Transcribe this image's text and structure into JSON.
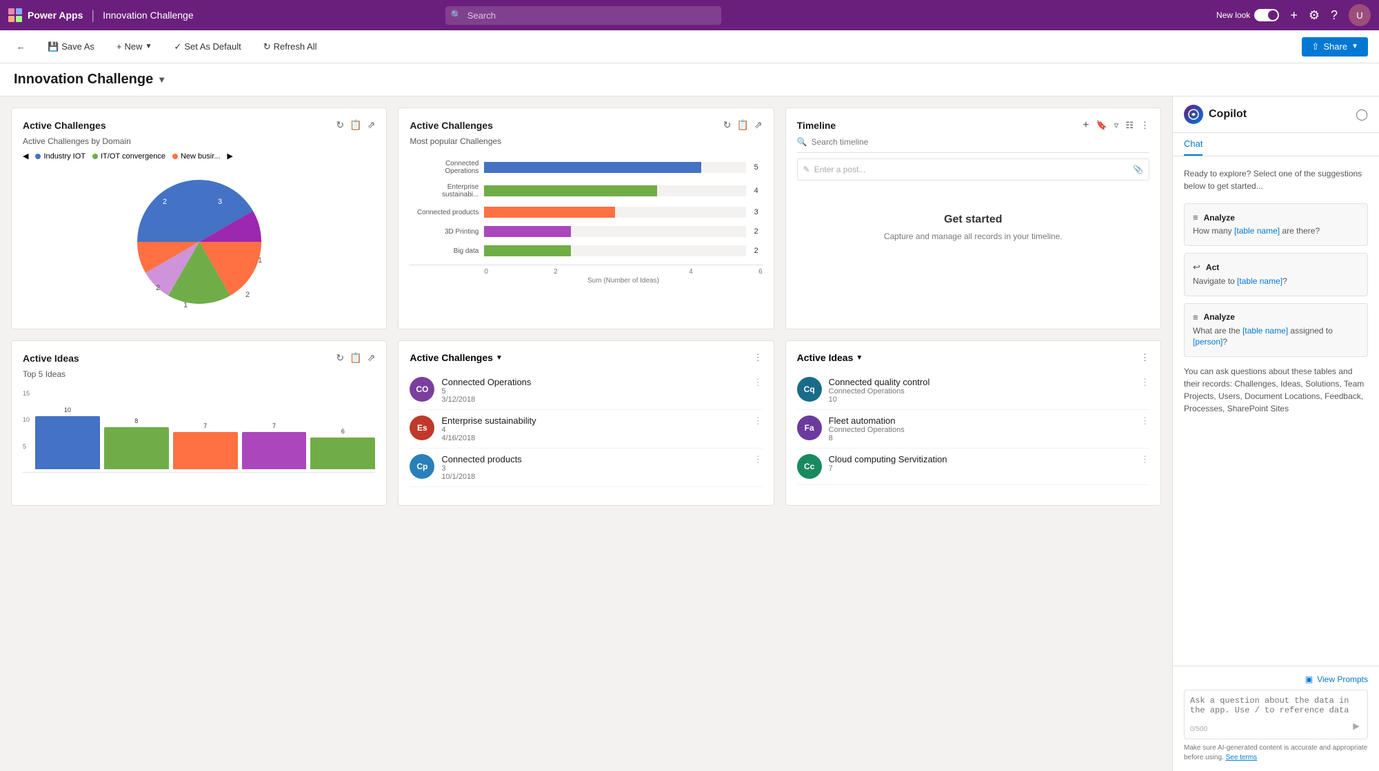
{
  "topNav": {
    "brand": "Power Apps",
    "separator": "|",
    "appTitle": "Innovation Challenge",
    "searchPlaceholder": "Search",
    "newLookLabel": "New look",
    "icons": [
      "plus",
      "settings",
      "help",
      "profile"
    ]
  },
  "toolbar": {
    "saveAs": "Save As",
    "new": "New",
    "setAsDefault": "Set As Default",
    "refreshAll": "Refresh All",
    "share": "Share"
  },
  "pageTitle": "Innovation Challenge",
  "copilot": {
    "title": "Copilot",
    "tabs": [
      "Chat"
    ],
    "activeTab": "Chat",
    "intro": "Ready to explore? Select one of the suggestions below to get started...",
    "suggestions": [
      {
        "type": "Analyze",
        "icon": "list",
        "text": "How many [table name] are there?"
      },
      {
        "type": "Act",
        "icon": "reply",
        "text": "Navigate to [table name]?"
      },
      {
        "type": "Analyze",
        "icon": "list",
        "text": "What are the [table name] assigned to [person]?"
      }
    ],
    "info": "You can ask questions about these tables and their records: Challenges, Ideas, Solutions, Team Projects, Users, Document Locations, Feedback, Processes, SharePoint Sites",
    "viewPrompts": "View Prompts",
    "inputPlaceholder": "Ask a question about the data in the app. Use / to reference data",
    "charCount": "0/500",
    "disclaimer": "Make sure AI-generated content is accurate and appropriate before using.",
    "seeTerms": "See terms"
  },
  "activeChallengePieCard": {
    "title": "Active Challenges",
    "subtitle": "Active Challenges by Domain",
    "legendItems": [
      {
        "label": "Industry IOT",
        "color": "#4472c4"
      },
      {
        "label": "IT/OT convergence",
        "color": "#70ad47"
      },
      {
        "label": "New busir...",
        "color": "#ff7043"
      }
    ],
    "pieData": [
      {
        "label": "3",
        "color": "#4472c4",
        "percent": 30
      },
      {
        "label": "1",
        "color": "#9c27b0",
        "percent": 10
      },
      {
        "label": "1",
        "color": "#ff7043",
        "percent": 10
      },
      {
        "label": "2",
        "color": "#ff7043",
        "percent": 15
      },
      {
        "label": "2",
        "color": "#70ad47",
        "percent": 15
      },
      {
        "label": "1",
        "color": "#ce93d8",
        "percent": 5
      },
      {
        "label": "2",
        "color": "#4472c4",
        "percent": 15
      }
    ]
  },
  "barChartCard": {
    "title": "Active Challenges",
    "subtitle": "Most popular Challenges",
    "bars": [
      {
        "label": "Connected Operations",
        "value": 5,
        "color": "#4472c4",
        "maxWidth": 83
      },
      {
        "label": "Enterprise sustainabi...",
        "value": 4,
        "color": "#70ad47",
        "maxWidth": 66
      },
      {
        "label": "Connected products",
        "value": 3,
        "color": "#ff7043",
        "maxWidth": 50
      },
      {
        "label": "3D Printing",
        "value": 2,
        "color": "#ab47bc",
        "maxWidth": 33
      },
      {
        "label": "Big data",
        "value": 2,
        "color": "#70ad47",
        "maxWidth": 33
      }
    ],
    "axisLabels": [
      "0",
      "2",
      "4",
      "6"
    ],
    "axisTitle": "Sum (Number of Ideas)"
  },
  "timelineCard": {
    "title": "Timeline",
    "searchPlaceholder": "Search timeline",
    "postPlaceholder": "Enter a post...",
    "emptyTitle": "Get started",
    "emptySubtitle": "Capture and manage all records in your timeline."
  },
  "activeIdeasCard": {
    "title": "Active Ideas",
    "subtitle": "Top 5 Ideas",
    "yAxisLabels": [
      "15",
      "10",
      "5"
    ],
    "bars": [
      {
        "value": 10,
        "heightPercent": 67
      },
      {
        "value": 8,
        "heightPercent": 53
      },
      {
        "value": 7,
        "heightPercent": 47
      },
      {
        "value": 7,
        "heightPercent": 47
      },
      {
        "value": 6,
        "heightPercent": 40
      }
    ],
    "barColors": [
      "#4472c4",
      "#70ad47",
      "#ff7043",
      "#ab47bc",
      "#70ad47"
    ]
  },
  "challengesListCard": {
    "title": "Active Challenges",
    "items": [
      {
        "initials": "CO",
        "name": "Connected Operations",
        "count": "5",
        "date": "3/12/2018",
        "avatarColor": "#7b3f9e"
      },
      {
        "initials": "Es",
        "name": "Enterprise sustainability",
        "count": "4",
        "date": "4/16/2018",
        "avatarColor": "#c0392b"
      },
      {
        "initials": "Cp",
        "name": "Connected products",
        "count": "3",
        "date": "10/1/2018",
        "avatarColor": "#2980b9"
      }
    ]
  },
  "ideasListCard": {
    "title": "Active Ideas",
    "items": [
      {
        "initials": "Cq",
        "name": "Connected quality control",
        "sub": "Connected Operations",
        "count": "10",
        "avatarColor": "#1a6b8a"
      },
      {
        "initials": "Fa",
        "name": "Fleet automation",
        "sub": "Connected Operations",
        "count": "8",
        "avatarColor": "#6b3a9e"
      },
      {
        "initials": "Cc",
        "name": "Cloud computing Servitization",
        "sub": "",
        "count": "7",
        "avatarColor": "#1a8a5e"
      }
    ]
  }
}
